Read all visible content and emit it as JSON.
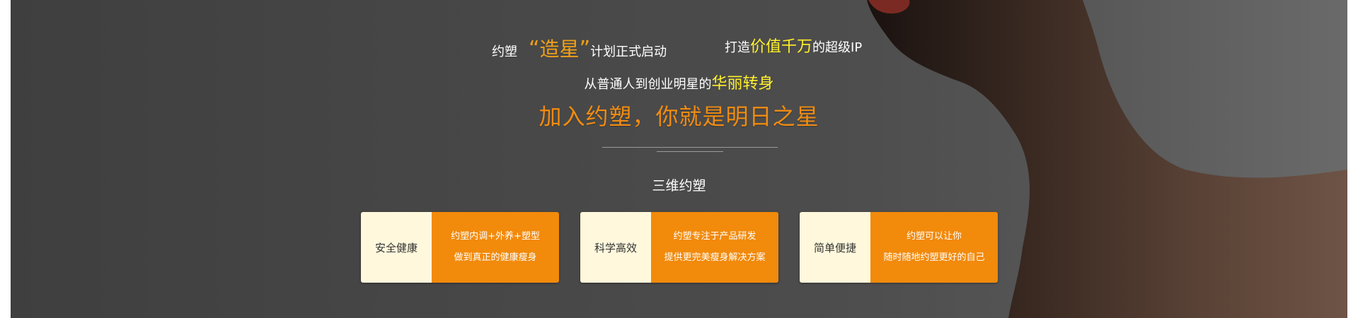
{
  "headline": {
    "part1": "约塑",
    "quote_open": "“",
    "highlight": "造星",
    "quote_close": "”",
    "part2": "计划正式启动",
    "part3": "打造",
    "highlight2": "价值千万",
    "part4": "的超级IP"
  },
  "subline": {
    "text": "从普通人到创业明星的",
    "highlight": "华丽转身"
  },
  "slogan": "加入约塑，你就是明日之星",
  "section_title": "三维约塑",
  "cards": [
    {
      "label": "安全健康",
      "line1": "约塑内调+外养+塑型",
      "line2": "做到真正的健康瘦身"
    },
    {
      "label": "科学高效",
      "line1": "约塑专注于产品研发",
      "line2": "提供更完美瘦身解决方案"
    },
    {
      "label": "简单便捷",
      "line1": "约塑可以让你",
      "line2": "随时随地约塑更好的自己"
    }
  ],
  "colors": {
    "accent_orange": "#f28a0b",
    "highlight_yellow": "#fff02a",
    "label_bg": "#fff8dc"
  }
}
